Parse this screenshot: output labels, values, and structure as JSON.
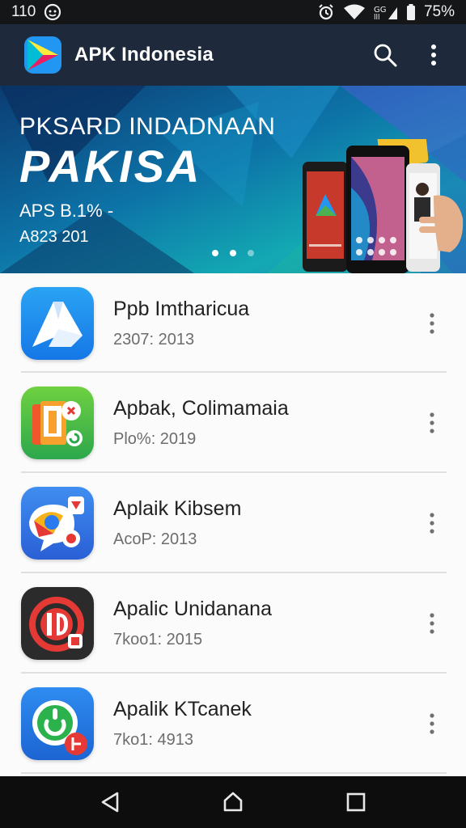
{
  "status_bar": {
    "time": "110",
    "battery": "75%",
    "icons": [
      "app-notification-icon",
      "alarm-icon",
      "wifi-icon",
      "signal-icon",
      "battery-icon"
    ]
  },
  "app_bar": {
    "title": "APK Indonesia",
    "icons": [
      "app-logo",
      "search-icon",
      "overflow-menu-icon"
    ]
  },
  "banner": {
    "line1": "PKSARD INDADNAAN",
    "line2": "PAKISA",
    "line3": "APS B.1% -",
    "line4": "A823 201",
    "active_slide": 2,
    "slide_count": 3
  },
  "apps": [
    {
      "title": "Ppb Imtharicua",
      "subtitle": "2307: 2013",
      "icon": "blue-arrow-app-icon"
    },
    {
      "title": "Apbak, Colimamaia",
      "subtitle": "Plo%: 2019",
      "icon": "green-docs-app-icon"
    },
    {
      "title": "Aplaik Kibsem",
      "subtitle": "AcoP: 2013",
      "icon": "blue-map-app-icon"
    },
    {
      "title": "Apalic Unidanana",
      "subtitle": "7koo1: 2015",
      "icon": "dark-red-app-icon"
    },
    {
      "title": "Apalik KTcanek",
      "subtitle": "7ko1: 4913",
      "icon": "blue-green-power-app-icon"
    }
  ],
  "colors": {
    "status_bar": "#141618",
    "app_bar": "#1e2a3b",
    "list_bg": "#fbfbfb",
    "nav_bar": "#0d0d0d"
  }
}
